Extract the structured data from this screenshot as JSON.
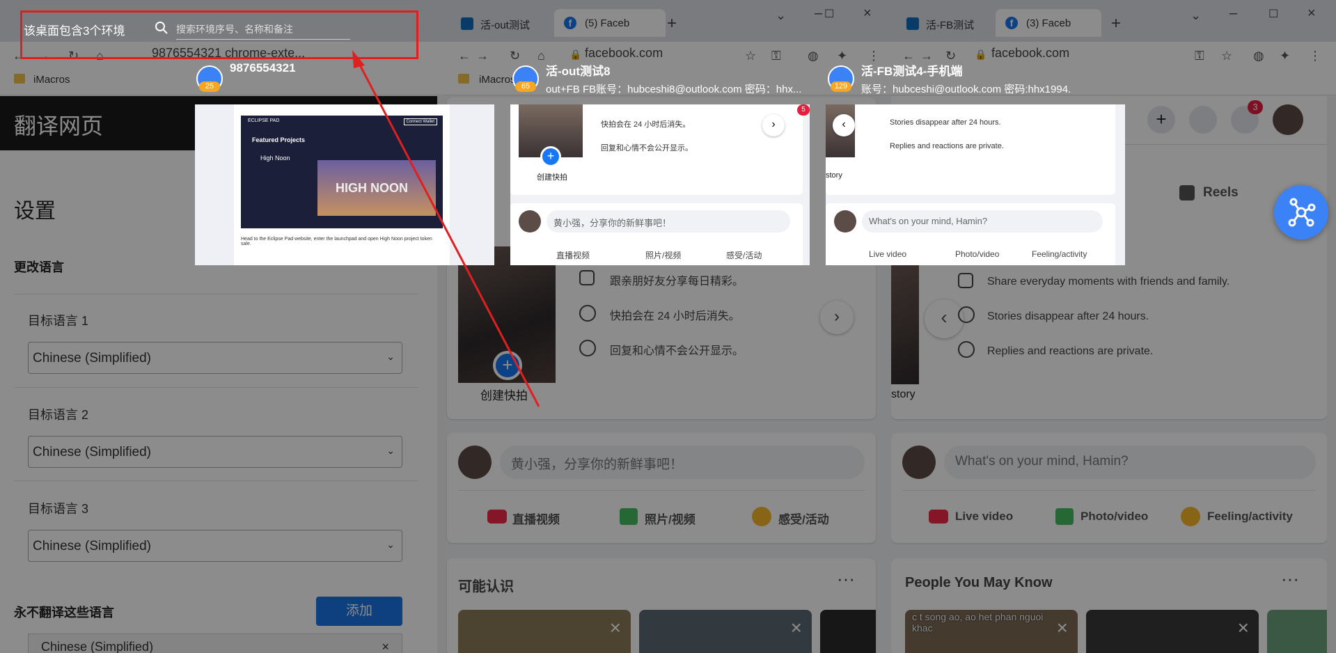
{
  "left_window": {
    "url": "9876554321 chrome-exte...",
    "bookmark": "iMacros",
    "translate_header": "翻译网页",
    "settings_title": "设置",
    "change_language": "更改语言",
    "target1_label": "目标语言 1",
    "target2_label": "目标语言 2",
    "target3_label": "目标语言 3",
    "target1_value": "Chinese (Simplified)",
    "target2_value": "Chinese (Simplified)",
    "target3_value": "Chinese (Simplified)",
    "never_translate": "永不翻译这些语言",
    "add_button": "添加",
    "never_item": "Chinese (Simplified)"
  },
  "mid_window": {
    "tab1": "活-out测试",
    "tab2": "(5) Faceb",
    "url": "facebook.com",
    "bookmark": "iMacros",
    "story_row1": "跟亲朋好友分享每日精彩。",
    "story_row2": "快拍会在 24 小时后消失。",
    "story_row3": "回复和心情不会公开显示。",
    "create_story": "创建快拍",
    "composer_placeholder": "黄小强，分享你的新鲜事吧！",
    "live": "直播视频",
    "photo": "照片/视频",
    "feeling": "感受/活动",
    "people_title": "可能认识"
  },
  "right_window": {
    "tab1": "活-FB测试",
    "tab2": "(3) Faceb",
    "url": "facebook.com",
    "reels": "Reels",
    "notif_count": "3",
    "story_row1": "Share everyday moments with friends and family.",
    "story_row2": "Stories disappear after 24 hours.",
    "story_row3": "Replies and reactions are private.",
    "story_label": "story",
    "composer_placeholder": "What's on your mind, Hamin?",
    "live": "Live video",
    "photo": "Photo/video",
    "feeling": "Feeling/activity",
    "people_title": "People You May Know",
    "people_card_text": "c t song ao, ao het phan nguoi khac"
  },
  "overlay": {
    "header": "该桌面包含3个环境",
    "search_placeholder": "搜索环境序号、名称和备注",
    "env1": {
      "title": "9876554321",
      "badge": "25"
    },
    "env2": {
      "title": "活-out测试8",
      "subtitle": "out+FB FB账号：hubceshi8@outlook.com 密码：hhx...",
      "badge": "65"
    },
    "env3": {
      "title": "活-FB测试4-手机端",
      "subtitle": "账号：hubceshi@outlook.com 密码:hhx1994.",
      "badge": "129"
    },
    "thumb1": {
      "brand": "ECLIPSE PAD",
      "featured": "Featured Projects",
      "project": "High Noon",
      "banner": "HIGH NOON",
      "connect": "Connect Wallet",
      "desc": "Head to the Eclipse Pad website, enter the launchpad and open High Noon project token sale."
    },
    "thumb2": {
      "row2": "快拍会在 24 小时后消失。",
      "row3": "回复和心情不会公开显示。",
      "create": "创建快拍",
      "composer": "黄小强，分享你的新鲜事吧！",
      "live": "直播视频",
      "photo": "照片/视频",
      "feeling": "感受/活动",
      "badge": "5"
    },
    "thumb3": {
      "row2": "Stories disappear after 24 hours.",
      "row3": "Replies and reactions are private.",
      "story": "story",
      "composer": "What's on your mind, Hamin?",
      "live": "Live video",
      "photo": "Photo/video",
      "feeling": "Feeling/activity"
    }
  },
  "colors": {
    "accent_red": "#e02020",
    "fb_blue": "#1877f2",
    "badge_orange": "#f5a623",
    "float_btn": "#3b82f6"
  }
}
